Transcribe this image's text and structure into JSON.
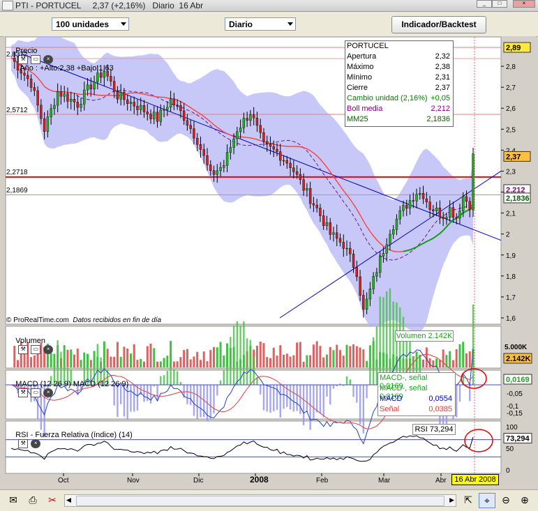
{
  "window": {
    "title": "PTI - PORTUCEL     2,37 (+2,16%)   Diario  16 Abr",
    "controls": [
      "minimize",
      "maximize",
      "close"
    ]
  },
  "toolbar": {
    "units_combo": "100 unidades",
    "period_combo": "Diario",
    "indicator_button": "Indicador/Backtest"
  },
  "price_panel": {
    "header_label": "Precio",
    "header_stats": "Año : +Alto:2,38 +Bajo:1,63",
    "left_levels": [
      "2,8372",
      "2,5712",
      "2,2718",
      "2,1869"
    ],
    "watermark": "© ProRealTime.com",
    "data_note": "Datos recibidos en fin de día",
    "axis": [
      "2,89",
      "2,8",
      "2,7",
      "2,6",
      "2,5",
      "2,4",
      "2,37",
      "2,3",
      "2,212",
      "2,2",
      "2,1836",
      "2,1",
      "2",
      "1,9",
      "1,8",
      "1,7",
      "1,6"
    ],
    "tag_top": "2,89",
    "tag_close": "2,37",
    "tag_boll": "2,212",
    "tag_mm": "2,1836"
  },
  "info_box": {
    "title": "PORTUCEL",
    "rows": [
      {
        "k": "Apertura",
        "v": "2,32",
        "color": "#000000"
      },
      {
        "k": "Máximo",
        "v": "2,38",
        "color": "#000000"
      },
      {
        "k": "Mínimo",
        "v": "2,31",
        "color": "#000000"
      },
      {
        "k": "Cierre",
        "v": "2,37",
        "color": "#000000"
      },
      {
        "k": "Cambio unidad (2,16%)",
        "v": "+0,05",
        "color": "#008000"
      },
      {
        "k": "Boll media",
        "v": "2,212",
        "color": "#800080"
      },
      {
        "k": "MM25",
        "v": "2,1836",
        "color": "#006400"
      }
    ]
  },
  "volume_panel": {
    "header_label": "Volumen",
    "value_label": "Volumen 2.142K",
    "axis_top": "5.000K",
    "tag_value": "2.142K"
  },
  "macd_panel": {
    "header_label": "MACD (12 26 9) MACD (12 26 9)",
    "legend": [
      {
        "k": "MACD-, señal 0,0169",
        "v": "",
        "color": "#20a020"
      },
      {
        "k": "MACD-, señal 0,0169",
        "v": "",
        "color": "#20a020"
      },
      {
        "k": "MACD",
        "v": "0,0554",
        "color": "#0000c0"
      },
      {
        "k": "Señal",
        "v": "0,0385",
        "color": "#e04040"
      }
    ],
    "axis": [
      "0,0169",
      "-0,05",
      "-0,1",
      "-0,15"
    ],
    "tag_value": "0,0169"
  },
  "rsi_panel": {
    "header_label": "RSI - Fuerza Relativa (índice) (14)",
    "value_label": "RSI 73,294",
    "axis": [
      "100",
      "73,294",
      "50",
      "0"
    ],
    "tag_value": "73,294"
  },
  "x_axis": {
    "labels": [
      "Oct",
      "Nov",
      "Dic",
      "2008",
      "Feb",
      "Mar",
      "Abr"
    ],
    "current_date": "16 Abr 2008"
  },
  "colors": {
    "boll_band": "#b4b4f5",
    "boll_mid": "#6a1a8a",
    "mm_red": "#ff4040",
    "mm_green": "#10a010",
    "up": "#20b020",
    "down": "#d02020",
    "trend": "#0000cc",
    "panel_bg": "#ffffff"
  }
}
